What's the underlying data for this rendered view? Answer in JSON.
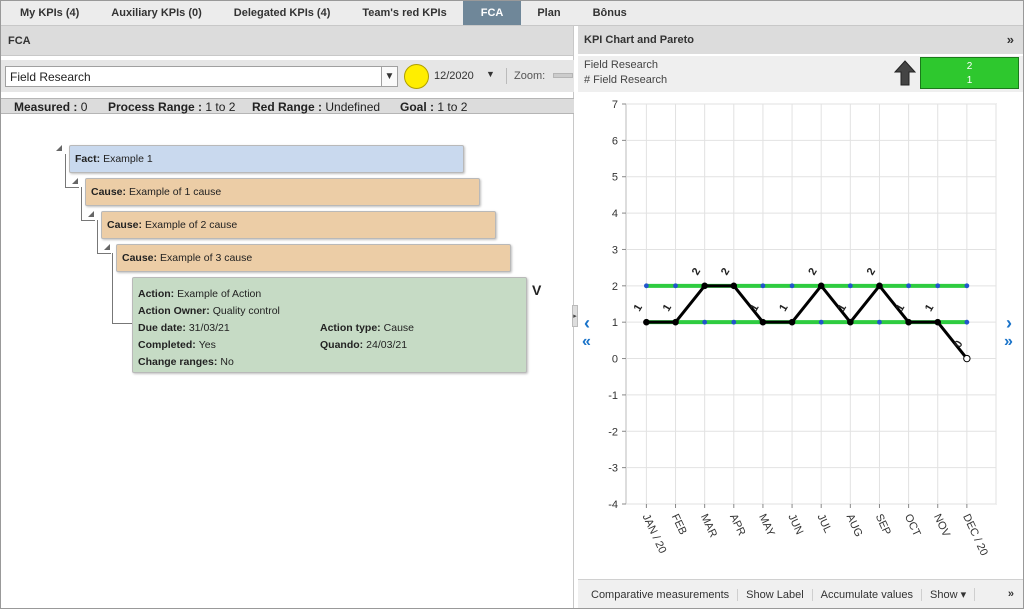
{
  "tabs": [
    {
      "label": "My KPIs (4)",
      "active": false
    },
    {
      "label": "Auxiliary KPIs (0)",
      "active": false
    },
    {
      "label": "Delegated KPIs (4)",
      "active": false
    },
    {
      "label": "Team's red KPIs",
      "active": false
    },
    {
      "label": "FCA",
      "active": true
    },
    {
      "label": "Plan",
      "active": false
    },
    {
      "label": "Bônus",
      "active": false
    }
  ],
  "fca": {
    "title": "FCA",
    "selected_kpi": "Field Research",
    "status_color": "#ffee00",
    "date": "12/2020",
    "zoom_label": "Zoom:",
    "ranges": {
      "measured_label": "Measured :",
      "measured_value": "0",
      "process_label": "Process Range :",
      "process_value": "1 to 2",
      "red_label": "Red Range :",
      "red_value": "Undefined",
      "goal_label": "Goal :",
      "goal_value": "1 to 2"
    },
    "fact": {
      "label": "Fact:",
      "text": "Example 1"
    },
    "causes": [
      {
        "label": "Cause:",
        "text": "Example of 1 cause"
      },
      {
        "label": "Cause:",
        "text": "Example of 2 cause"
      },
      {
        "label": "Cause:",
        "text": "Example of 3 cause"
      }
    ],
    "action": {
      "action_label": "Action:",
      "action_text": "Example of Action",
      "owner_label": "Action Owner:",
      "owner_text": "Quality control",
      "due_label": "Due date:",
      "due_text": "31/03/21",
      "type_label": "Action type:",
      "type_text": "Cause",
      "completed_label": "Completed:",
      "completed_text": "Yes",
      "quando_label": "Quando:",
      "quando_text": "24/03/21",
      "change_label": "Change ranges:",
      "change_text": "No"
    },
    "verify_mark": "V"
  },
  "kpi": {
    "title": "KPI Chart and Pareto",
    "collapse_glyph": "»",
    "subtitle_1": "Field Research",
    "subtitle_2": "# Field Research",
    "box_top": "2",
    "box_bottom": "1",
    "box_color": "#2ec82e",
    "nav_prev": "‹",
    "nav_first": "«",
    "nav_next": "›",
    "nav_last": "»",
    "toolbar": {
      "comparative": "Comparative measurements",
      "show_label": "Show Label",
      "accumulate": "Accumulate values",
      "show": "Show ▾",
      "more": "»"
    }
  },
  "chart_data": {
    "type": "line",
    "categories": [
      "JAN / 20",
      "FEB",
      "MAR",
      "APR",
      "MAY",
      "JUN",
      "JUL",
      "AUG",
      "SEP",
      "OCT",
      "NOV",
      "DEC / 20"
    ],
    "series": [
      {
        "values": [
          1,
          1,
          2,
          2,
          1,
          1,
          2,
          1,
          2,
          1,
          1,
          0
        ],
        "color": "#000000"
      }
    ],
    "upper_range": 2,
    "lower_range": 1,
    "range_color": "#2ecc40",
    "range_point_color": "#2255cc",
    "ylim": [
      -4,
      7
    ],
    "yticks": [
      -4,
      -3,
      -2,
      -1,
      0,
      1,
      2,
      3,
      4,
      5,
      6,
      7
    ],
    "grid": true
  }
}
